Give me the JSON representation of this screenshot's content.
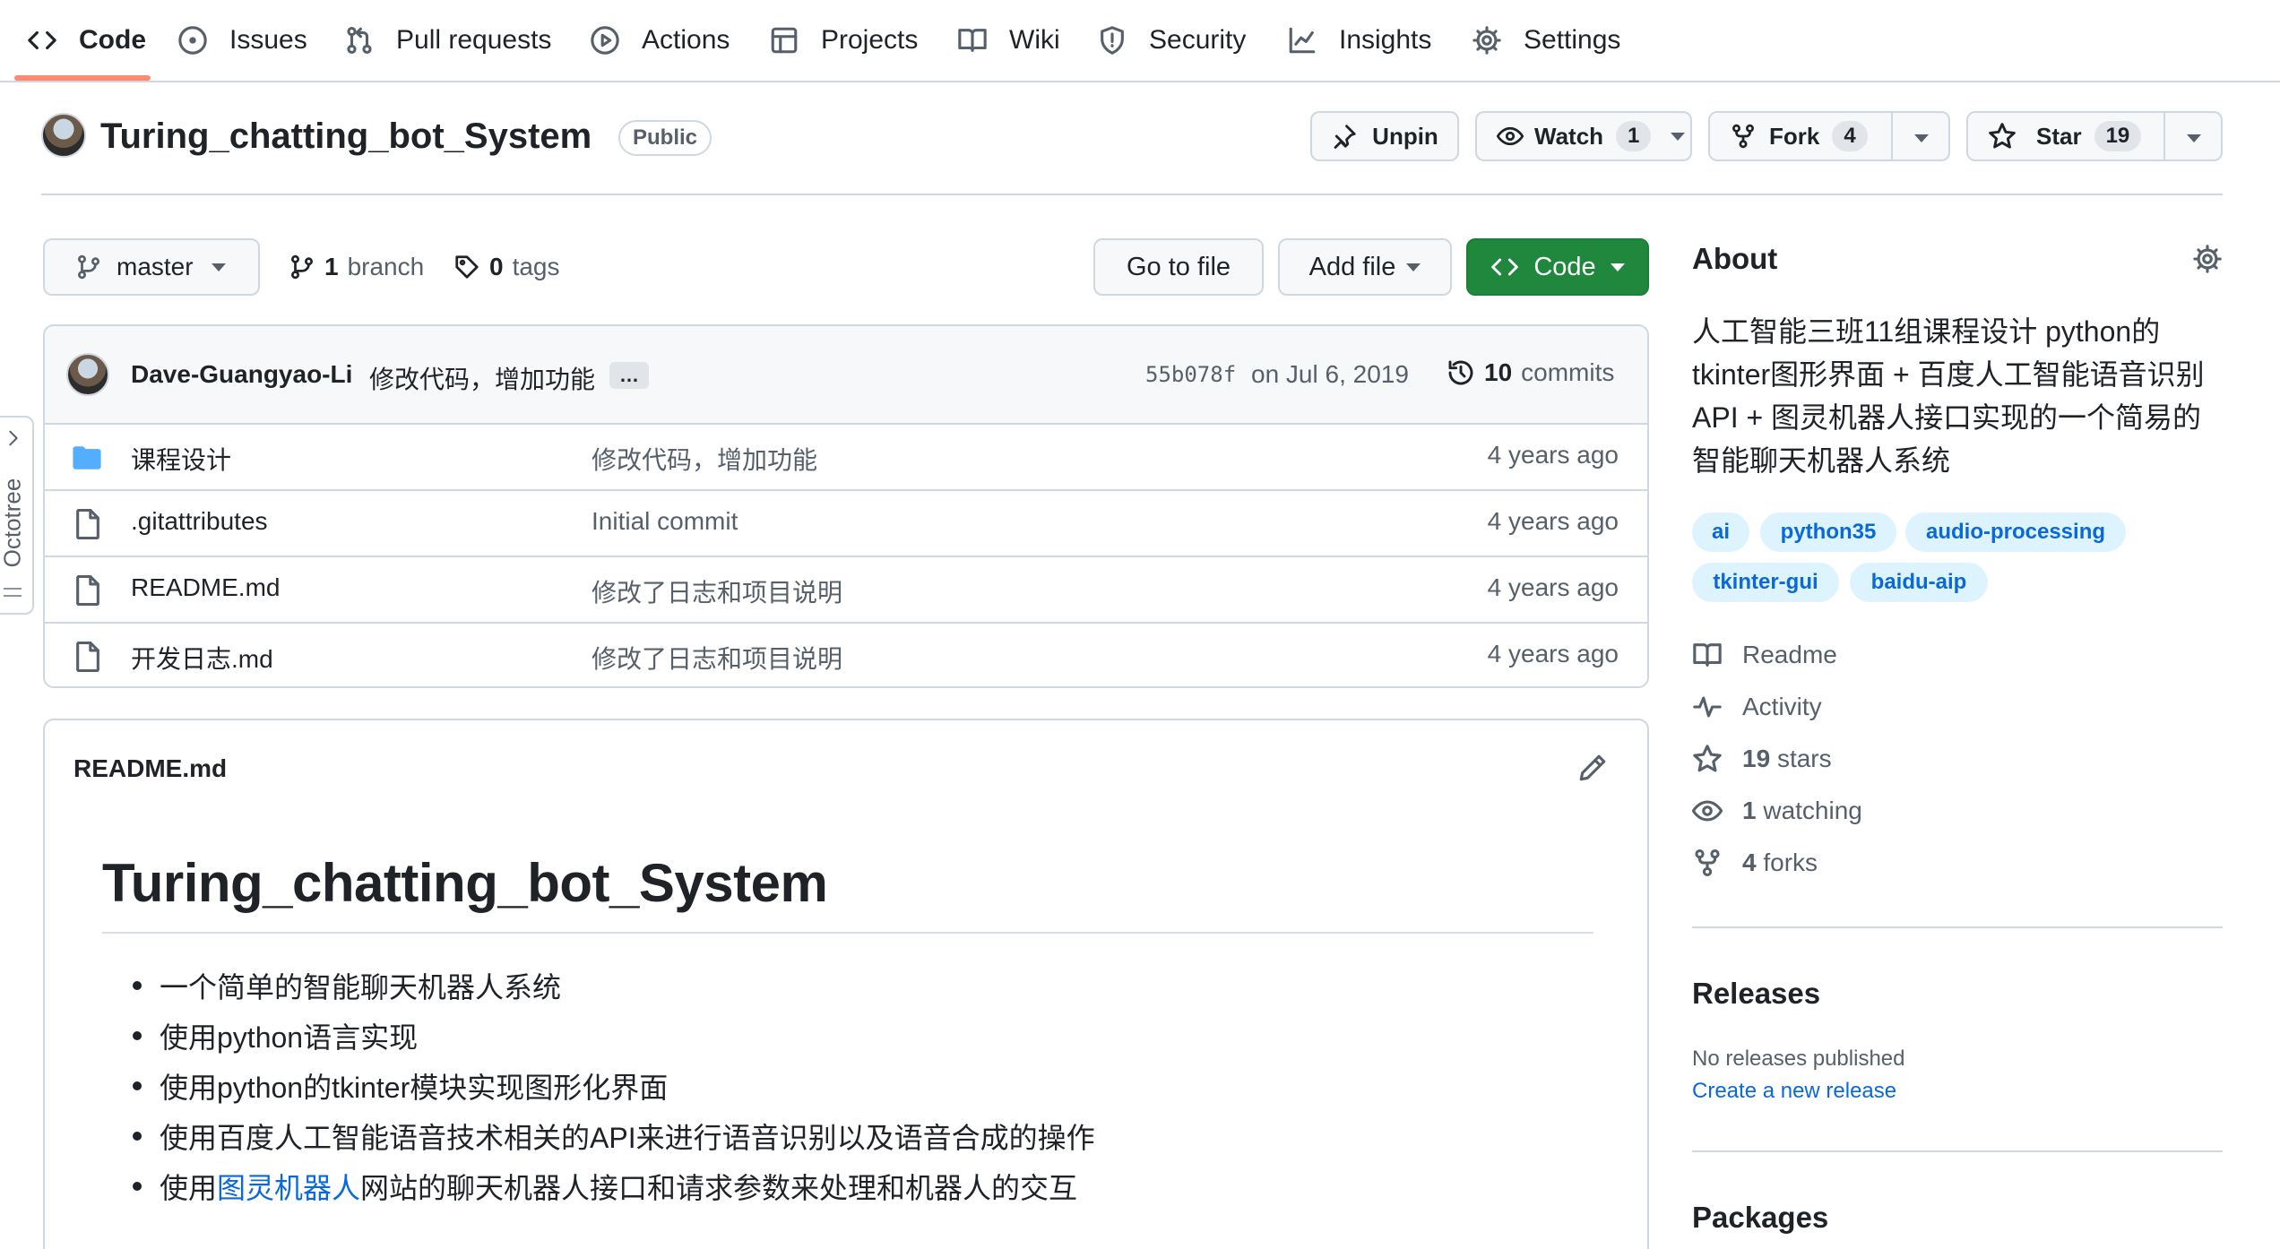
{
  "tabs": [
    {
      "label": "Code",
      "icon": "code-icon",
      "active": true
    },
    {
      "label": "Issues",
      "icon": "issue-icon"
    },
    {
      "label": "Pull requests",
      "icon": "pull-request-icon"
    },
    {
      "label": "Actions",
      "icon": "play-icon"
    },
    {
      "label": "Projects",
      "icon": "table-icon"
    },
    {
      "label": "Wiki",
      "icon": "book-icon"
    },
    {
      "label": "Security",
      "icon": "shield-icon"
    },
    {
      "label": "Insights",
      "icon": "graph-icon"
    },
    {
      "label": "Settings",
      "icon": "gear-icon"
    }
  ],
  "repo": {
    "name": "Turing_chatting_bot_System",
    "visibility": "Public",
    "unpin_label": "Unpin",
    "watch_label": "Watch",
    "watch_count": "1",
    "fork_label": "Fork",
    "fork_count": "4",
    "star_label": "Star",
    "star_count": "19"
  },
  "toolbar": {
    "branch": "master",
    "branch_count": "1",
    "branch_word": "branch",
    "tag_count": "0",
    "tag_word": "tags",
    "go_to_file": "Go to file",
    "add_file": "Add file",
    "code": "Code"
  },
  "commit": {
    "author": "Dave-Guangyao-Li",
    "message": "修改代码，增加功能",
    "ellipsis": "…",
    "sha": "55b078f",
    "date": "on Jul 6, 2019",
    "count": "10",
    "count_word": "commits"
  },
  "files": [
    {
      "name": "课程设计",
      "type": "folder",
      "message": "修改代码，增加功能",
      "age": "4 years ago"
    },
    {
      "name": ".gitattributes",
      "type": "file",
      "message": "Initial commit",
      "age": "4 years ago"
    },
    {
      "name": "README.md",
      "type": "file",
      "message": "修改了日志和项目说明",
      "age": "4 years ago"
    },
    {
      "name": "开发日志.md",
      "type": "file",
      "message": "修改了日志和项目说明",
      "age": "4 years ago"
    }
  ],
  "readme": {
    "filename": "README.md",
    "heading": "Turing_chatting_bot_System",
    "bullets": [
      "一个简单的智能聊天机器人系统",
      "使用python语言实现",
      "使用python的tkinter模块实现图形化界面",
      "使用百度人工智能语音技术相关的API来进行语音识别以及语音合成的操作"
    ],
    "last_bullet_prefix": "使用",
    "last_bullet_link": "图灵机器人",
    "last_bullet_suffix": "网站的聊天机器人接口和请求参数来处理和机器人的交互"
  },
  "about": {
    "title": "About",
    "description": "人工智能三班11组课程设计 python的tkinter图形界面 + 百度人工智能语音识别API + 图灵机器人接口实现的一个简易的智能聊天机器人系统",
    "topics": [
      "ai",
      "python35",
      "audio-processing",
      "tkinter-gui",
      "baidu-aip"
    ],
    "readme": "Readme",
    "activity": "Activity",
    "stars_count": "19",
    "stars_word": "stars",
    "watching_count": "1",
    "watching_word": "watching",
    "forks_count": "4",
    "forks_word": "forks"
  },
  "releases": {
    "title": "Releases",
    "none": "No releases published",
    "create": "Create a new release"
  },
  "packages": {
    "title": "Packages"
  },
  "octotree": {
    "label": "Octotree"
  },
  "colors": {
    "accent": "#0969da",
    "primary_button": "#1f883d",
    "tab_underline": "#fd8c73",
    "folder": "#54aeff"
  }
}
